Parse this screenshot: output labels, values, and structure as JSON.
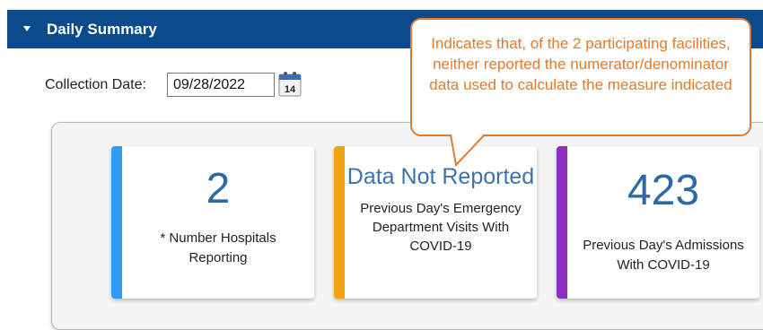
{
  "section": {
    "title": "Daily Summary"
  },
  "filter": {
    "label": "Collection Date:",
    "value": "09/28/2022",
    "calendar_day": "14"
  },
  "cards": [
    {
      "value": "2",
      "description": "* Number Hospitals Reporting",
      "accent": "#2f9bf0"
    },
    {
      "value": "Data Not Reported",
      "description": "Previous Day's Emergency Department Visits With COVID-19",
      "accent": "#f0a20f"
    },
    {
      "value": "423",
      "description": "Previous Day's Admissions With COVID-19",
      "accent": "#8e2fc1"
    }
  ],
  "callout": {
    "text": "Indicates that, of the 2 participating facilities, neither reported the numerator/denominator data used to calculate the measure indicated"
  },
  "colors": {
    "header": "#0b4a8b",
    "callout": "#e07a2e",
    "value_text": "#2b6aa6"
  }
}
